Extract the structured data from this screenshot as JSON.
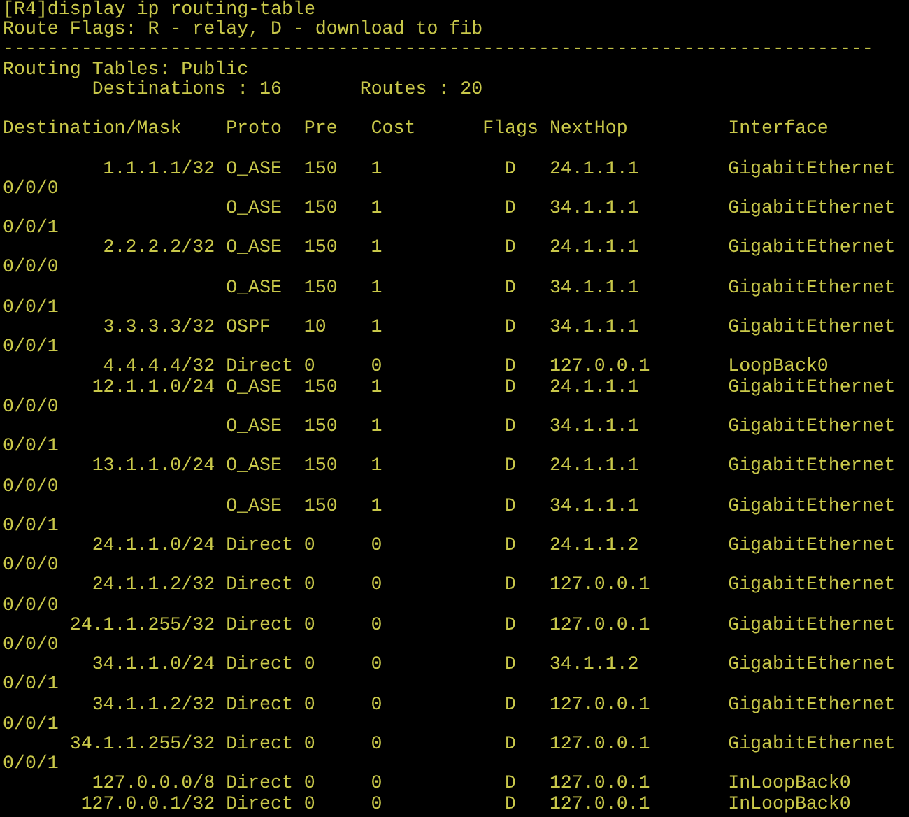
{
  "terminal": {
    "command_line": "[R4]display ip routing-table",
    "flags_legend": "Route Flags: R - relay, D - download to fib",
    "separator": "------------------------------------------------------------------------------",
    "table_title": "Routing Tables: Public",
    "summary": "        Destinations : 16       Routes : 20",
    "columns": [
      "Destination/Mask",
      "Proto",
      "Pre",
      "Cost",
      "Flags",
      "NextHop",
      "Interface"
    ],
    "rows": [
      {
        "destination": "1.1.1.1/32",
        "proto": "O_ASE",
        "pre": "150",
        "cost": "1",
        "flags": "D",
        "nexthop": "24.1.1.1",
        "interface": "GigabitEthernet",
        "interface_wrap": "0/0/0"
      },
      {
        "proto": "O_ASE",
        "pre": "150",
        "cost": "1",
        "flags": "D",
        "nexthop": "34.1.1.1",
        "interface": "GigabitEthernet",
        "interface_wrap": "0/0/1"
      },
      {
        "destination": "2.2.2.2/32",
        "proto": "O_ASE",
        "pre": "150",
        "cost": "1",
        "flags": "D",
        "nexthop": "24.1.1.1",
        "interface": "GigabitEthernet",
        "interface_wrap": "0/0/0"
      },
      {
        "proto": "O_ASE",
        "pre": "150",
        "cost": "1",
        "flags": "D",
        "nexthop": "34.1.1.1",
        "interface": "GigabitEthernet",
        "interface_wrap": "0/0/1"
      },
      {
        "destination": "3.3.3.3/32",
        "proto": "OSPF",
        "pre": "10",
        "cost": "1",
        "flags": "D",
        "nexthop": "34.1.1.1",
        "interface": "GigabitEthernet",
        "interface_wrap": "0/0/1"
      },
      {
        "destination": "4.4.4.4/32",
        "proto": "Direct",
        "pre": "0",
        "cost": "0",
        "flags": "D",
        "nexthop": "127.0.0.1",
        "interface": "LoopBack0"
      },
      {
        "destination": "12.1.1.0/24",
        "proto": "O_ASE",
        "pre": "150",
        "cost": "1",
        "flags": "D",
        "nexthop": "24.1.1.1",
        "interface": "GigabitEthernet",
        "interface_wrap": "0/0/0"
      },
      {
        "proto": "O_ASE",
        "pre": "150",
        "cost": "1",
        "flags": "D",
        "nexthop": "34.1.1.1",
        "interface": "GigabitEthernet",
        "interface_wrap": "0/0/1"
      },
      {
        "destination": "13.1.1.0/24",
        "proto": "O_ASE",
        "pre": "150",
        "cost": "1",
        "flags": "D",
        "nexthop": "24.1.1.1",
        "interface": "GigabitEthernet",
        "interface_wrap": "0/0/0"
      },
      {
        "proto": "O_ASE",
        "pre": "150",
        "cost": "1",
        "flags": "D",
        "nexthop": "34.1.1.1",
        "interface": "GigabitEthernet",
        "interface_wrap": "0/0/1"
      },
      {
        "destination": "24.1.1.0/24",
        "proto": "Direct",
        "pre": "0",
        "cost": "0",
        "flags": "D",
        "nexthop": "24.1.1.2",
        "interface": "GigabitEthernet",
        "interface_wrap": "0/0/0"
      },
      {
        "destination": "24.1.1.2/32",
        "proto": "Direct",
        "pre": "0",
        "cost": "0",
        "flags": "D",
        "nexthop": "127.0.0.1",
        "interface": "GigabitEthernet",
        "interface_wrap": "0/0/0"
      },
      {
        "destination": "24.1.1.255/32",
        "proto": "Direct",
        "pre": "0",
        "cost": "0",
        "flags": "D",
        "nexthop": "127.0.0.1",
        "interface": "GigabitEthernet",
        "interface_wrap": "0/0/0"
      },
      {
        "destination": "34.1.1.0/24",
        "proto": "Direct",
        "pre": "0",
        "cost": "0",
        "flags": "D",
        "nexthop": "34.1.1.2",
        "interface": "GigabitEthernet",
        "interface_wrap": "0/0/1"
      },
      {
        "destination": "34.1.1.2/32",
        "proto": "Direct",
        "pre": "0",
        "cost": "0",
        "flags": "D",
        "nexthop": "127.0.0.1",
        "interface": "GigabitEthernet",
        "interface_wrap": "0/0/1"
      },
      {
        "destination": "34.1.1.255/32",
        "proto": "Direct",
        "pre": "0",
        "cost": "0",
        "flags": "D",
        "nexthop": "127.0.0.1",
        "interface": "GigabitEthernet",
        "interface_wrap": "0/0/1"
      },
      {
        "destination": "127.0.0.0/8",
        "proto": "Direct",
        "pre": "0",
        "cost": "0",
        "flags": "D",
        "nexthop": "127.0.0.1",
        "interface": "InLoopBack0"
      },
      {
        "destination": "127.0.0.1/32",
        "proto": "Direct",
        "pre": "0",
        "cost": "0",
        "flags": "D",
        "nexthop": "127.0.0.1",
        "interface": "InLoopBack0"
      }
    ]
  }
}
